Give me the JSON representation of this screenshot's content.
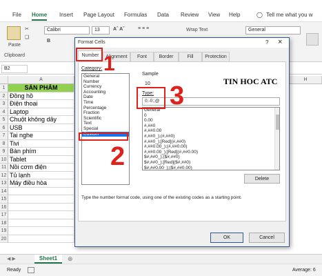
{
  "menu": {
    "file": "File",
    "home": "Home",
    "insert": "Insert",
    "page_layout": "Page Layout",
    "formulas": "Formulas",
    "data": "Data",
    "review": "Review",
    "view": "View",
    "help": "Help",
    "tell_me": "Tell me what you w"
  },
  "ribbon": {
    "paste": "Paste",
    "clipboard": "Clipboard",
    "font_name": "Calibri",
    "font_size": "13",
    "wrap_text": "Wrap Text",
    "number_format": "General"
  },
  "formula_bar": {
    "name_box": "B2"
  },
  "columns": {
    "a": "A",
    "h": "H"
  },
  "rows": [
    {
      "num": "1",
      "a": "SẢN PHẨM"
    },
    {
      "num": "2",
      "a": "Đồng hồ"
    },
    {
      "num": "3",
      "a": "Điện thoại"
    },
    {
      "num": "4",
      "a": "Laptop"
    },
    {
      "num": "5",
      "a": "Chuột không dây"
    },
    {
      "num": "6",
      "a": "USB"
    },
    {
      "num": "7",
      "a": "Tai nghe"
    },
    {
      "num": "8",
      "a": "Tivi"
    },
    {
      "num": "9",
      "a": "Bàn phím"
    },
    {
      "num": "10",
      "a": "Tablet"
    },
    {
      "num": "11",
      "a": "Nồi cơm điện"
    },
    {
      "num": "12",
      "a": "Tủ lạnh"
    },
    {
      "num": "13",
      "a": "Máy điều hòa"
    },
    {
      "num": "14",
      "a": ""
    },
    {
      "num": "15",
      "a": ""
    },
    {
      "num": "16",
      "a": ""
    },
    {
      "num": "17",
      "a": ""
    },
    {
      "num": "18",
      "a": ""
    },
    {
      "num": "19",
      "a": ""
    },
    {
      "num": "20",
      "a": ""
    }
  ],
  "dialog": {
    "title": "Format Cells",
    "tabs": [
      "Number",
      "Alignment",
      "Font",
      "Border",
      "Fill",
      "Protection"
    ],
    "category_label": "Category:",
    "categories": [
      "General",
      "Number",
      "Currency",
      "Accounting",
      "Date",
      "Time",
      "Percentage",
      "Fraction",
      "Scientific",
      "Text",
      "Special",
      "Custom"
    ],
    "selected_category": "Custom",
    "sample_label": "Sample",
    "sample_value": "10",
    "type_label": "Type:",
    "type_value": "0;-0;;@",
    "types": [
      "General",
      "0",
      "0.00",
      "#,##0",
      "#,##0.00",
      "#,##0_);(#,##0)",
      "#,##0_);[Red](#,##0)",
      "#,##0.00_);(#,##0.00)",
      "#,##0.00_);[Red](#,##0.00)",
      "$#,##0_);($#,##0)",
      "$#,##0_);[Red]($#,##0)",
      "$#,##0.00_);($#,##0.00)"
    ],
    "delete_label": "Delete",
    "description": "Type the number format code, using one of the existing codes as a starting point.",
    "ok_label": "OK",
    "cancel_label": "Cancel",
    "help_q": "?",
    "close_x": "×"
  },
  "watermark": "TIN HOC ATC",
  "annotations": {
    "one": "1",
    "two": "2",
    "three": "3"
  },
  "sheet_tab": "Sheet1",
  "status": {
    "ready": "Ready",
    "average": "Average: 6"
  },
  "colors": {
    "accent": "#217346",
    "marker": "#e0201b",
    "selection": "#1a73e8",
    "header_fill": "#92d050"
  }
}
